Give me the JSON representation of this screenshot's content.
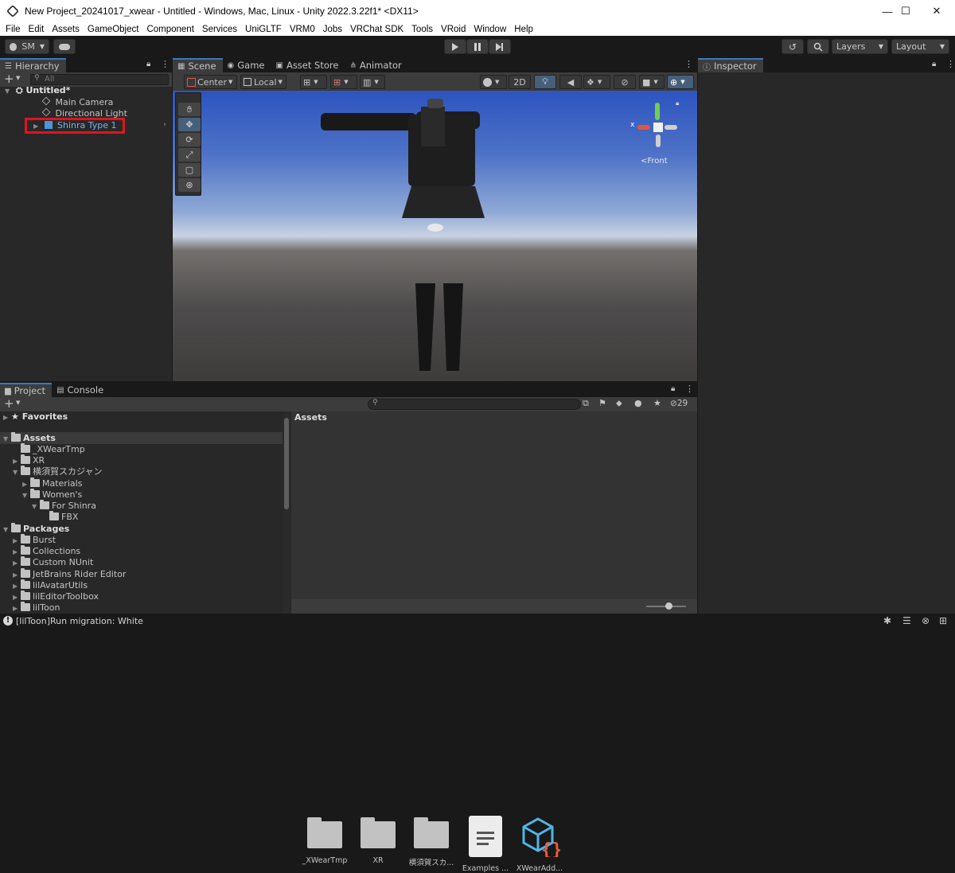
{
  "window": {
    "title": "New Project_20241017_xwear - Untitled - Windows, Mac, Linux - Unity 2022.3.22f1* <DX11>",
    "minimize": "—",
    "maximize": "☐",
    "close": "✕"
  },
  "menu": [
    "File",
    "Edit",
    "Assets",
    "GameObject",
    "Component",
    "Services",
    "UniGLTF",
    "VRM0",
    "Jobs",
    "VRChat SDK",
    "Tools",
    "VRoid",
    "Window",
    "Help"
  ],
  "toolbar": {
    "account": "SM",
    "play_icon": "play-icon",
    "pause_icon": "pause-icon",
    "step_icon": "step-icon",
    "layers": "Layers",
    "layout": "Layout"
  },
  "hierarchy": {
    "tab": "Hierarchy",
    "search_placeholder": "All",
    "scene": "Untitled*",
    "items": [
      "Main Camera",
      "Directional Light",
      "Shinra Type 1"
    ]
  },
  "scene_tabs": [
    "Scene",
    "Game",
    "Asset Store",
    "Animator"
  ],
  "scene_toolbar": {
    "pivot": "Center",
    "space": "Local",
    "mode_2d": "2D"
  },
  "gizmo": {
    "x": "x",
    "view": "Front"
  },
  "inspector": {
    "tab": "Inspector"
  },
  "project": {
    "tabs": [
      "Project",
      "Console"
    ],
    "hidden_count": "29",
    "favorites": "Favorites",
    "assets_root": "Assets",
    "tree": [
      {
        "label": "_XWearTmp",
        "indent": 1,
        "arrow": ""
      },
      {
        "label": "XR",
        "indent": 1,
        "arrow": "▶"
      },
      {
        "label": "横須賀スカジャン",
        "indent": 1,
        "arrow": "▼"
      },
      {
        "label": "Materials",
        "indent": 2,
        "arrow": "▶"
      },
      {
        "label": "Women's",
        "indent": 2,
        "arrow": "▼"
      },
      {
        "label": "For Shinra",
        "indent": 3,
        "arrow": "▼"
      },
      {
        "label": "FBX",
        "indent": 4,
        "arrow": ""
      }
    ],
    "packages_root": "Packages",
    "packages": [
      "Burst",
      "Collections",
      "Custom NUnit",
      "JetBrains Rider Editor",
      "lilAvatarUtils",
      "lilEditorToolbox",
      "lilToon"
    ],
    "breadcrumb": "Assets",
    "assets": [
      {
        "label": "_XWearTmp",
        "kind": "folder"
      },
      {
        "label": "XR",
        "kind": "folder"
      },
      {
        "label": "横須賀スカ...",
        "kind": "folder"
      },
      {
        "label": "Examples ...",
        "kind": "document"
      },
      {
        "label": "XWearAdd...",
        "kind": "package"
      }
    ]
  },
  "status": {
    "message": "[lilToon]Run migration: White"
  },
  "colors": {
    "accent": "#3a79bb",
    "highlight_box": "#e0141e",
    "selected_text": "#7fb0ec"
  }
}
